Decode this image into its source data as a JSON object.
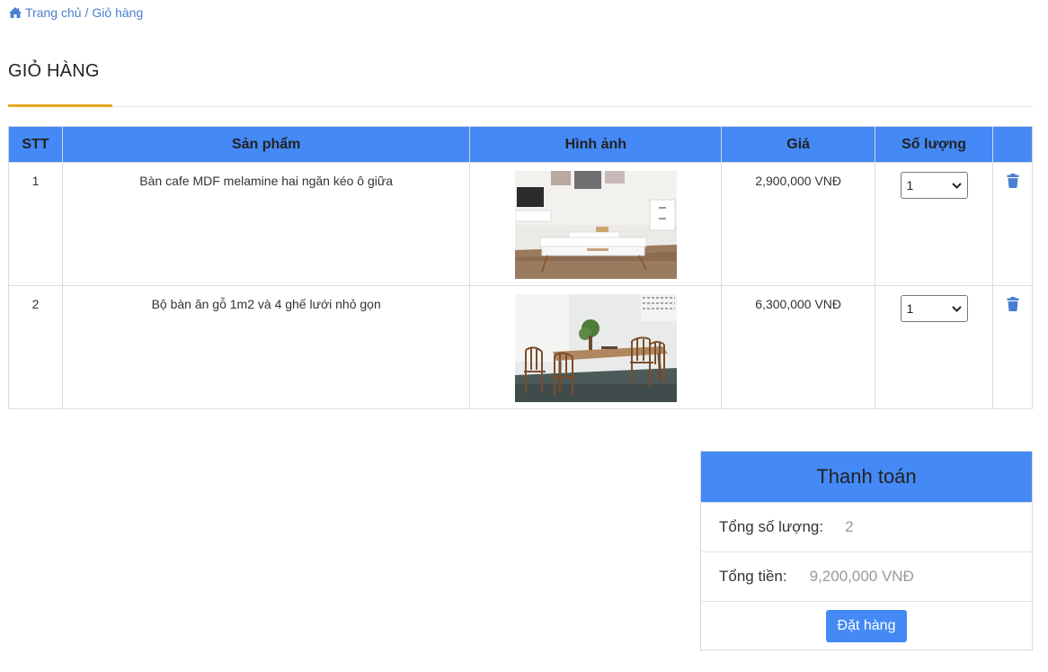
{
  "breadcrumb": {
    "home": "Trang chủ",
    "separator": "/",
    "current": "Giỏ hàng"
  },
  "page_title": "GIỎ HÀNG",
  "table": {
    "headers": [
      "STT",
      "Sản phẩm",
      "Hình ảnh",
      "Giá",
      "Số lượng",
      ""
    ],
    "rows": [
      {
        "stt": "1",
        "name": "Bàn cafe MDF melamine hai ngăn kéo ô giữa",
        "image": "coffee-table-photo",
        "price": "2,900,000 VNĐ",
        "qty": "1"
      },
      {
        "stt": "2",
        "name": "Bộ bàn ăn gỗ 1m2 và 4 ghế lưới nhỏ gọn",
        "image": "dining-set-photo",
        "price": "6,300,000 VNĐ",
        "qty": "1"
      }
    ]
  },
  "checkout": {
    "title": "Thanh toán",
    "qty_label": "Tổng số lượng:",
    "qty_value": "2",
    "total_label": "Tổng tiền:",
    "total_value": "9,200,000 VNĐ",
    "order_button": "Đặt hàng"
  },
  "colors": {
    "primary": "#4489f5",
    "accent": "#e8a820",
    "link": "#4a7fd0"
  },
  "icons": {
    "home": "home-icon",
    "delete": "trash-icon",
    "select": "chevron-down-icon"
  }
}
